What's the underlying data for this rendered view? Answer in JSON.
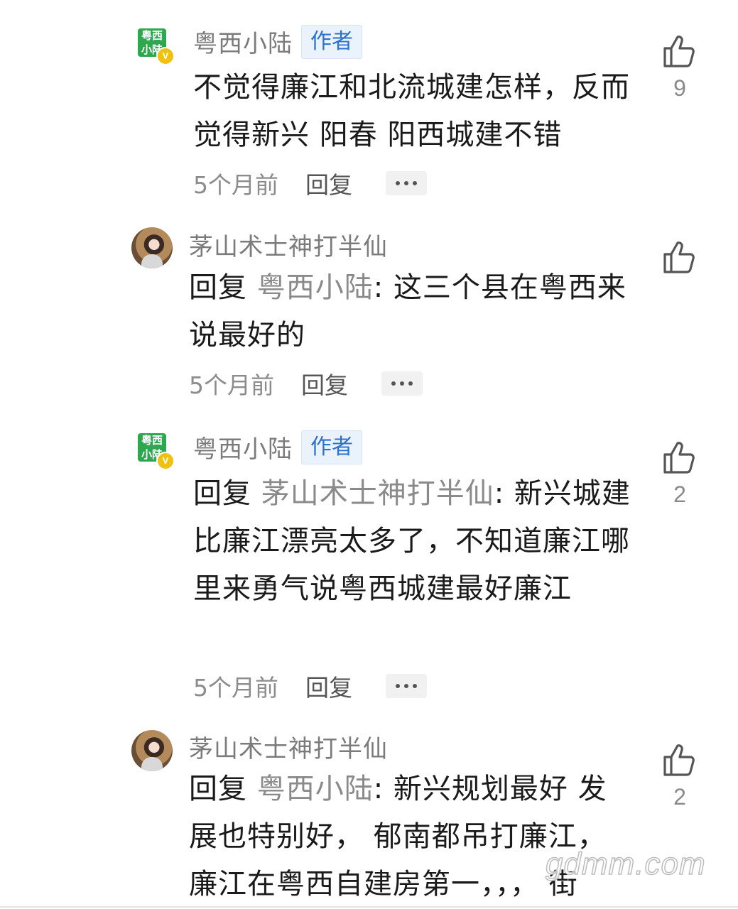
{
  "comments": [
    {
      "username": "粤西小陆",
      "badge": "作者",
      "avatar_logo": {
        "line1": "粤西",
        "line2": "小陆",
        "verified_mark": "V"
      },
      "text": "不觉得廉江和北流城建怎样，反而觉得新兴 阳春 阳西城建不错",
      "time": "5个月前",
      "reply_label": "回复",
      "likes": "9"
    },
    {
      "username": "茅山术士神打半仙",
      "reply_prefix": "回复 ",
      "reply_target": "粤西小陆",
      "text": ": 这三个县在粤西来说最好的",
      "time": "5个月前",
      "reply_label": "回复",
      "likes": ""
    },
    {
      "username": "粤西小陆",
      "badge": "作者",
      "avatar_logo": {
        "line1": "粤西",
        "line2": "小陆",
        "verified_mark": "V"
      },
      "reply_prefix": "回复 ",
      "reply_target": "茅山术士神打半仙",
      "text": ": 新兴城建比廉江漂亮太多了，不知道廉江哪里来勇气说粤西城建最好廉江",
      "time": "5个月前",
      "reply_label": "回复",
      "likes": "2"
    },
    {
      "username": "茅山术士神打半仙",
      "reply_prefix": "回复 ",
      "reply_target": "粤西小陆",
      "text": ": 新兴规划最好 发展也特别好， 郁南都吊打廉江，廉江在粤西自建房第一，，， 街",
      "likes": "2"
    }
  ],
  "watermark": "gdmm.com",
  "icons": {
    "like": "thumbs-up-icon",
    "more": "more-dots-icon",
    "verified": "verified-badge-icon"
  },
  "colors": {
    "author_badge_text": "#2a73cf",
    "author_badge_bg": "#eaf2fb",
    "logo_green": "#2ea84f",
    "verified_yellow": "#f2c10f"
  }
}
